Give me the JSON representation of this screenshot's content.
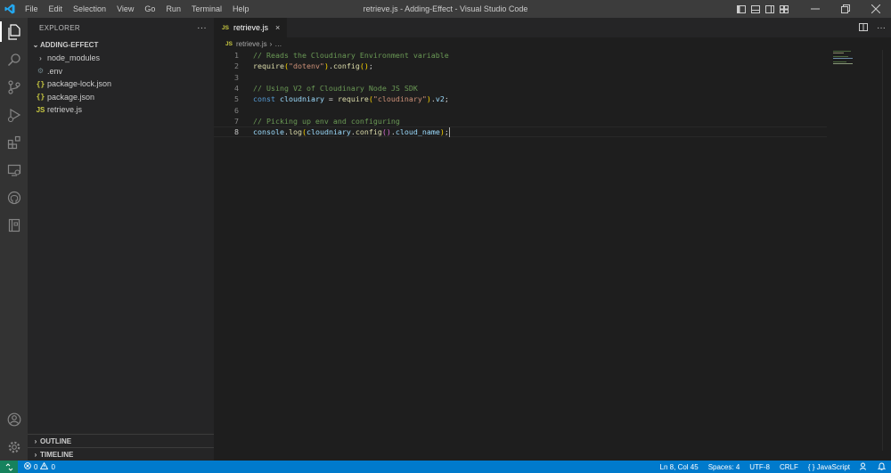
{
  "titlebar": {
    "menu": [
      "File",
      "Edit",
      "Selection",
      "View",
      "Go",
      "Run",
      "Terminal",
      "Help"
    ],
    "window_title": "retrieve.js - Adding-Effect - Visual Studio Code"
  },
  "sidebar": {
    "header": "EXPLORER",
    "more": "···",
    "folder": "ADDING-EFFECT",
    "items": [
      {
        "label": "node_modules",
        "icon": "chevron-right-icon"
      },
      {
        "label": ".env",
        "icon": "gear-icon"
      },
      {
        "label": "package-lock.json",
        "icon": "json-icon"
      },
      {
        "label": "package.json",
        "icon": "json-icon"
      },
      {
        "label": "retrieve.js",
        "icon": "js-icon"
      }
    ],
    "outline": "OUTLINE",
    "timeline": "TIMELINE"
  },
  "editor": {
    "tab_label": "retrieve.js",
    "tab_icon": "JS",
    "close": "×",
    "breadcrumb_file": "retrieve.js",
    "breadcrumb_more": "…",
    "lines": [
      "1",
      "2",
      "3",
      "4",
      "5",
      "6",
      "7",
      "8"
    ]
  },
  "statusbar": {
    "errors": "0",
    "warnings": "0",
    "position": "Ln 8, Col 45",
    "spaces": "Spaces: 4",
    "encoding": "UTF-8",
    "eol": "CRLF",
    "language": "JavaScript",
    "language_braces": "{ }"
  },
  "colors": {
    "accent": "#007acc",
    "remote": "#16825d",
    "logo": "#23a9f2"
  }
}
